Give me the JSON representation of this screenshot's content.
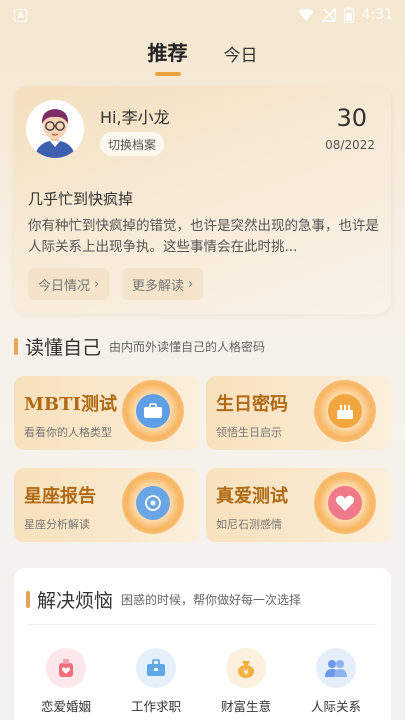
{
  "status_bar": {
    "time": "4:31",
    "left_icon": "A"
  },
  "tabs": [
    {
      "label": "推荐",
      "active": true
    },
    {
      "label": "今日",
      "active": false
    }
  ],
  "profile": {
    "greeting": "Hi,李小龙",
    "switch_label": "切换档案",
    "day": "30",
    "month_year": "08/2022"
  },
  "daily": {
    "title": "几乎忙到快疯掉",
    "text": "你有种忙到快疯掉的错觉，也许是突然出现的急事，也许是人际关系上出现争执。这些事情会在此时挑...",
    "btn_today": "今日情况",
    "btn_more": "更多解读"
  },
  "understand": {
    "title": "读懂自己",
    "subtitle": "由内而外读懂自己的人格密码",
    "cards": [
      {
        "title": "MBTI测试",
        "sub": "看看你的人格类型",
        "icon": "briefcase-icon"
      },
      {
        "title": "生日密码",
        "sub": "领悟生日启示",
        "icon": "birthday-cake-icon"
      },
      {
        "title": "星座报告",
        "sub": "星座分析解读",
        "icon": "constellation-icon"
      },
      {
        "title": "真爱测试",
        "sub": "如尼石测感情",
        "icon": "heart-icon"
      }
    ]
  },
  "solve": {
    "title": "解决烦恼",
    "subtitle": "困惑的时候，帮你做好每一次选择",
    "items": [
      {
        "label": "恋爱婚姻",
        "icon": "love-marriage-icon",
        "color": "#f06d7b",
        "bg": "#fde7ea"
      },
      {
        "label": "工作求职",
        "icon": "job-briefcase-icon",
        "color": "#5fa8e8",
        "bg": "#e4f1fc"
      },
      {
        "label": "财富生意",
        "icon": "money-bag-icon",
        "color": "#f2b13f",
        "bg": "#fdf0dc"
      },
      {
        "label": "人际关系",
        "icon": "people-icon",
        "color": "#6a98ea",
        "bg": "#e6edfc"
      }
    ]
  },
  "colors": {
    "accent": "#e9a23b",
    "card_title": "#b06a14"
  }
}
